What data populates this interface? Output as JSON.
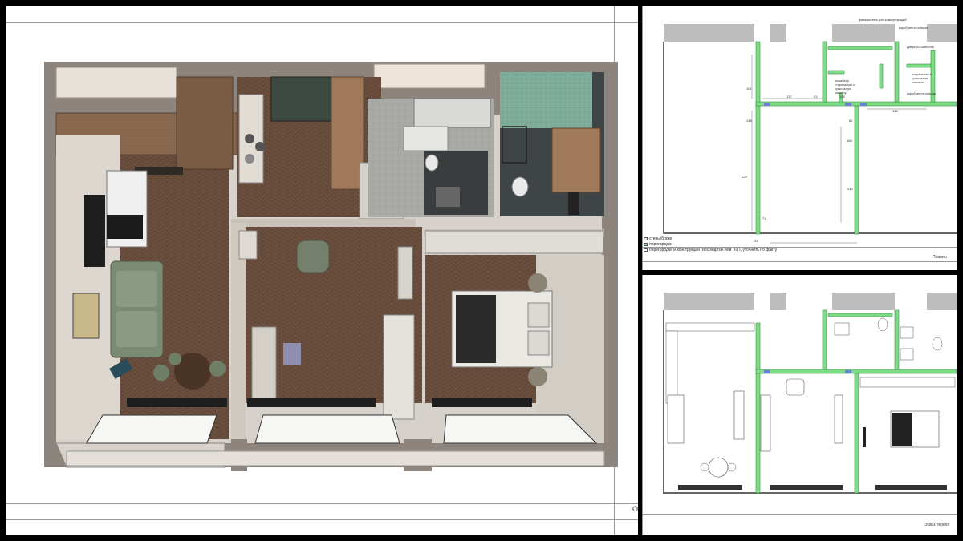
{
  "main_sheet": {
    "corner_mark": "О"
  },
  "top_right_sheet": {
    "legend": [
      {
        "text": "стены/блоки",
        "color": "#e8e8e8"
      },
      {
        "text": "перегородки",
        "color": "#7ddc85"
      },
      {
        "text": "перегородки и конструкции гипсокартон или ПГП, уточнить по факту",
        "color": "#ffffff"
      }
    ],
    "corner_label": "Планир",
    "notes": [
      "фальшстена для коммуникаций",
      "короб инсталляции",
      "ниша под стиральную и сушильную машину",
      "стиральная и сушильная машина",
      "короб инсталляции",
      "дверь по шаблону"
    ],
    "dims": [
      "137",
      "83",
      "108",
      "168",
      "160",
      "229",
      "240",
      "71",
      "101",
      "62",
      "248",
      "31"
    ]
  },
  "bottom_right_sheet": {
    "corner_label": "Эскиз перепл"
  },
  "colors": {
    "wall_green": "#7ddc85",
    "parquet": "#6b4f3e",
    "tile_green": "#7fae9a",
    "sofa": "#7b8a72"
  }
}
